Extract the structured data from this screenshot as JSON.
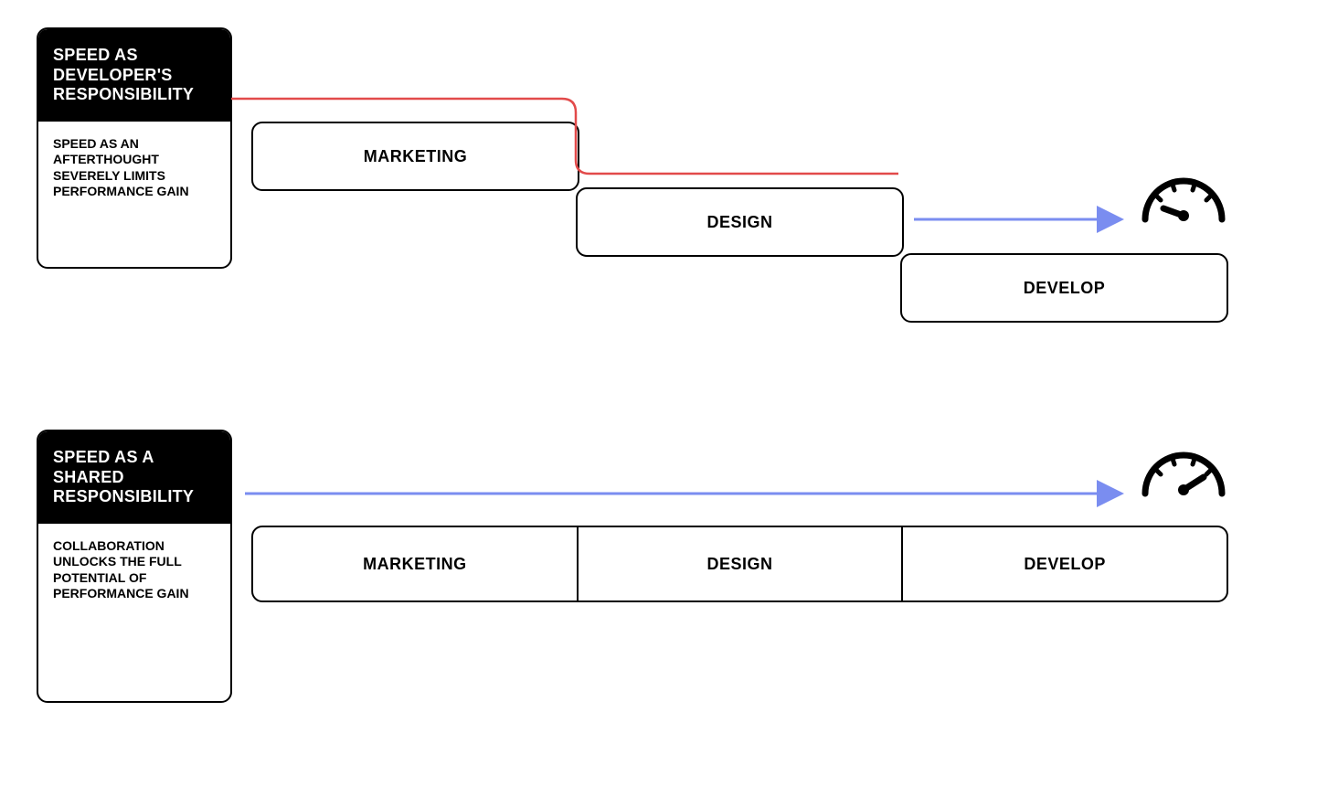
{
  "top": {
    "title": "SPEED AS DEVELOPER'S RESPONSIBILITY",
    "subtitle": "SPEED AS AN AFTERTHOUGHT SEVERELY LIMITS PERFORMANCE GAIN",
    "stages": {
      "a": "MARKETING",
      "b": "DESIGN",
      "c": "DEVELOP"
    }
  },
  "bottom": {
    "title": "SPEED AS A SHARED RESPONSIBILITY",
    "subtitle": "COLLABORATION UNLOCKS THE FULL POTENTIAL OF PERFORMANCE GAIN",
    "stages": {
      "a": "MARKETING",
      "b": "DESIGN",
      "c": "DEVELOP"
    }
  },
  "colors": {
    "redLine": "#e24a4a",
    "blueArrow": "#7a8df0",
    "black": "#000000"
  }
}
